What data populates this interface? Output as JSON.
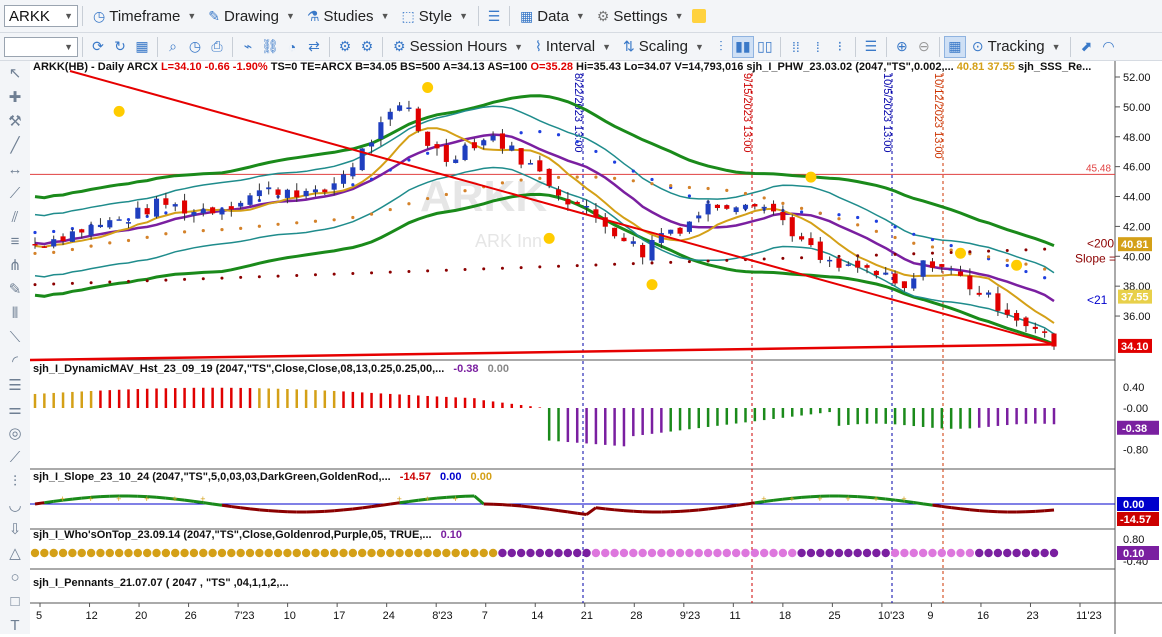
{
  "toolbar1": {
    "symbol": "ARKK",
    "items": [
      {
        "name": "timeframe",
        "label": "Timeframe"
      },
      {
        "name": "drawing",
        "label": "Drawing"
      },
      {
        "name": "studies",
        "label": "Studies"
      },
      {
        "name": "style",
        "label": "Style"
      },
      {
        "name": "data",
        "label": "Data"
      },
      {
        "name": "settings",
        "label": "Settings"
      }
    ]
  },
  "toolbar2": {
    "session_hours": "Session Hours",
    "interval": "Interval",
    "scaling": "Scaling",
    "tracking": "Tracking"
  },
  "main_header": {
    "symbol_info": "ARKK(HB) - Daily  ARCX",
    "stats": [
      {
        "text": "L=34.10",
        "color": "#e00000"
      },
      {
        "text": "-0.66",
        "color": "#e00000"
      },
      {
        "text": "-1.90%",
        "color": "#e00000"
      },
      {
        "text": "TS=0",
        "color": "#111111"
      },
      {
        "text": "TE=ARCX",
        "color": "#111111"
      },
      {
        "text": "B=34.05",
        "color": "#111111"
      },
      {
        "text": "BS=500",
        "color": "#111111"
      },
      {
        "text": "A=34.13",
        "color": "#111111"
      },
      {
        "text": "AS=100",
        "color": "#111111"
      },
      {
        "text": "O=35.28",
        "color": "#e00000"
      },
      {
        "text": "Hi=35.43",
        "color": "#111111"
      },
      {
        "text": "Lo=34.07",
        "color": "#111111"
      },
      {
        "text": "V=14,793,016",
        "color": "#111111"
      },
      {
        "text": "sjh_I_PHW_23.03.02 (2047,\"TS\",0.002,...",
        "color": "#111111"
      },
      {
        "text": "40.81",
        "color": "#d4a017"
      },
      {
        "text": "37.55",
        "color": "#d4a017"
      },
      {
        "text": "sjh_SSS_Re...",
        "color": "#111111"
      }
    ]
  },
  "watermark": {
    "symbol": "ARKK",
    "name": "ARK Inn"
  },
  "price_axis": {
    "ticks": [
      "52.00",
      "50.00",
      "48.00",
      "46.00",
      "44.00",
      "42.00",
      "40.00",
      "38.00",
      "36.00"
    ],
    "level_line": "45.48",
    "tags": [
      {
        "text": "40.81",
        "bg": "#d4a017",
        "fg": "#ffffff"
      },
      {
        "text": "37.55",
        "bg": "#e8d04a",
        "fg": "#ffffff"
      },
      {
        "text": "34.10",
        "bg": "#e00000",
        "fg": "#ffffff"
      }
    ],
    "side_labels": [
      {
        "text": "<200",
        "color": "#8b0000"
      },
      {
        "text": "Slope =",
        "color": "#8b0000"
      },
      {
        "text": "<21",
        "color": "#0000cc"
      }
    ]
  },
  "event_lines": [
    {
      "text": "8/22/2023 13:00",
      "color": "#0000aa"
    },
    {
      "text": "9/15/2023 13:00",
      "color": "#cc0000"
    },
    {
      "text": "10/5/2023 13:00",
      "color": "#0000aa"
    },
    {
      "text": "10/12/2023 13:00",
      "color": "#cc3300"
    }
  ],
  "panels": {
    "dynamic_mav": {
      "title": "sjh_I_DynamicMAV_Hst_23_09_19 (2047,\"TS\",Close,Close,08,13,0.25,0.25,00,...",
      "v1": "-0.38",
      "v2": "0.00",
      "ticks": [
        "0.40",
        "-0.00",
        "-0.40",
        "-0.80"
      ],
      "tag": "-0.38"
    },
    "slope": {
      "title": "sjh_I_Slope_23_10_24 (2047,\"TS\",5,0,03,03,DarkGreen,GoldenRod,...",
      "v1": "-14.57",
      "v2": "0.00",
      "v3": "0.00",
      "tags": [
        "0.00",
        "-14.57"
      ]
    },
    "whos_on_top": {
      "title": "sjh_I_Who'sOnTop_23.09.14 (2047,\"TS\",Close,Goldenrod,Purple,05,  TRUE,...",
      "v1": "0.10",
      "ticks": [
        "0.80",
        "-0.40"
      ],
      "tag": "0.10"
    },
    "pennants": {
      "title": "sjh_I_Pennants_21.07.07 (  2047 ,  \"TS\" ,04,1,1,2,..."
    }
  },
  "date_axis": [
    "5",
    "12",
    "20",
    "26",
    "7'23",
    "10",
    "17",
    "24",
    "8'23",
    "7",
    "14",
    "21",
    "28",
    "9'23",
    "11",
    "18",
    "25",
    "10'23",
    "9",
    "16",
    "23",
    "11'23"
  ],
  "colors": {
    "up": "#1f3fbf",
    "down": "#e00000",
    "envelope": "#1a8a1a",
    "teal": "#1f8c8c",
    "gold": "#d4a017",
    "purple": "#7a1fa0",
    "dotted_blue": "#1f3fdf",
    "dotted_orange": "#d4822a",
    "dotted_maroon": "#8b0000",
    "trend": "#e60000"
  }
}
